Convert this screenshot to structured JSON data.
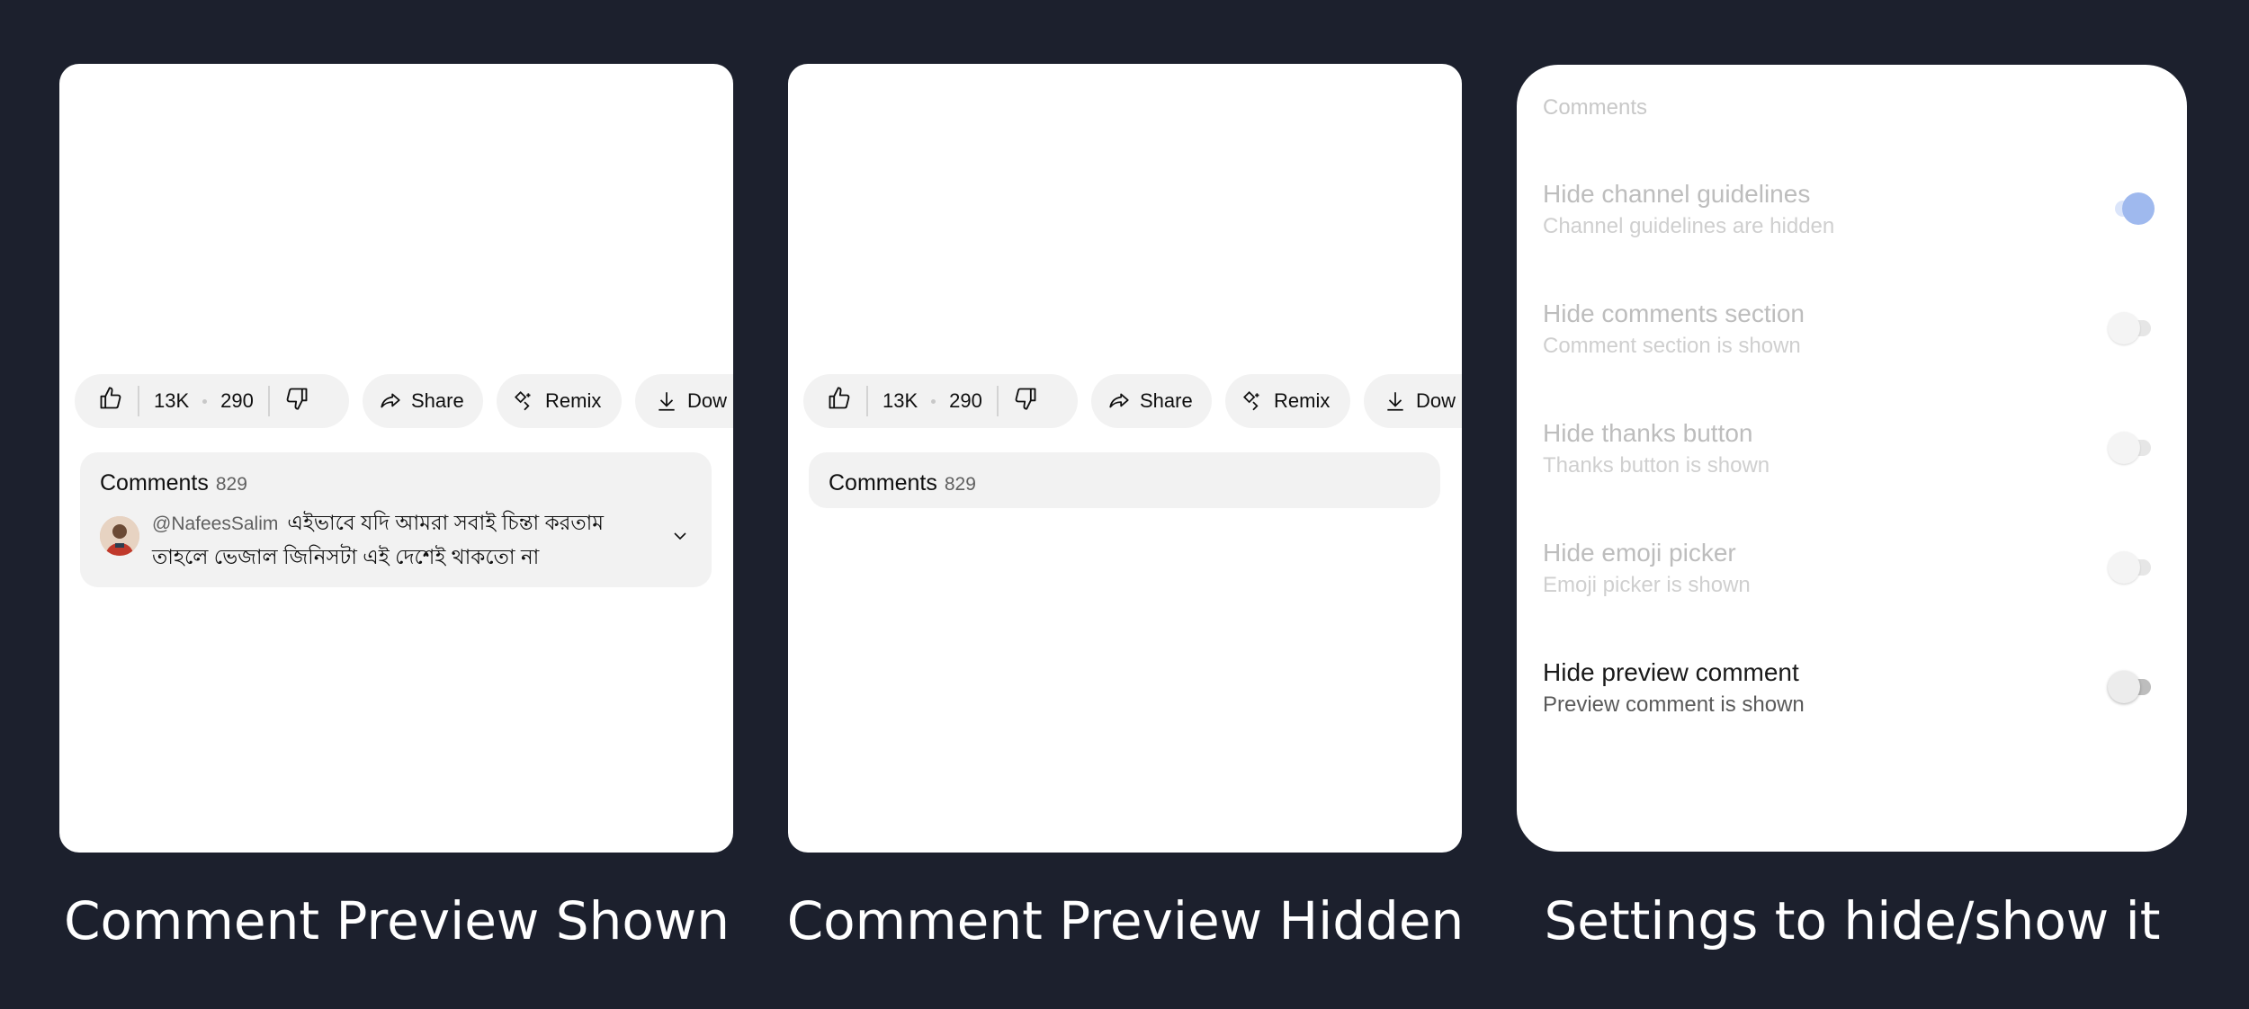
{
  "panels": [
    {
      "caption": "Comment Preview Shown",
      "actions": {
        "likes": "13K",
        "dislikes": "290",
        "share": "Share",
        "remix": "Remix",
        "download": "Dow"
      },
      "comments": {
        "title": "Comments",
        "count": "829",
        "preview": {
          "user": "@NafeesSalim",
          "text_line1": "এইভাবে যদি আমরা সবাই চিন্তা করতাম",
          "text_line2": "তাহলে ভেজাল জিনিসটা এই দেশেই থাকতো না"
        }
      }
    },
    {
      "caption": "Comment Preview Hidden",
      "actions": {
        "likes": "13K",
        "dislikes": "290",
        "share": "Share",
        "remix": "Remix",
        "download": "Dow"
      },
      "comments": {
        "title": "Comments",
        "count": "829"
      }
    },
    {
      "caption": "Settings to hide/show it",
      "settings": {
        "category": "Comments",
        "items": [
          {
            "title": "Hide channel guidelines",
            "subtitle": "Channel guidelines are hidden",
            "on": true,
            "enabled": false
          },
          {
            "title": "Hide comments section",
            "subtitle": "Comment section is shown",
            "on": false,
            "enabled": false
          },
          {
            "title": "Hide thanks button",
            "subtitle": "Thanks button is shown",
            "on": false,
            "enabled": false
          },
          {
            "title": "Hide emoji picker",
            "subtitle": "Emoji picker is shown",
            "on": false,
            "enabled": false
          },
          {
            "title": "Hide preview comment",
            "subtitle": "Preview comment is shown",
            "on": false,
            "enabled": true
          }
        ]
      }
    }
  ],
  "colors": {
    "background": "#1c202d",
    "card": "#ffffff",
    "chip": "#f2f2f2",
    "toggle_on": "#8fb0ef"
  }
}
